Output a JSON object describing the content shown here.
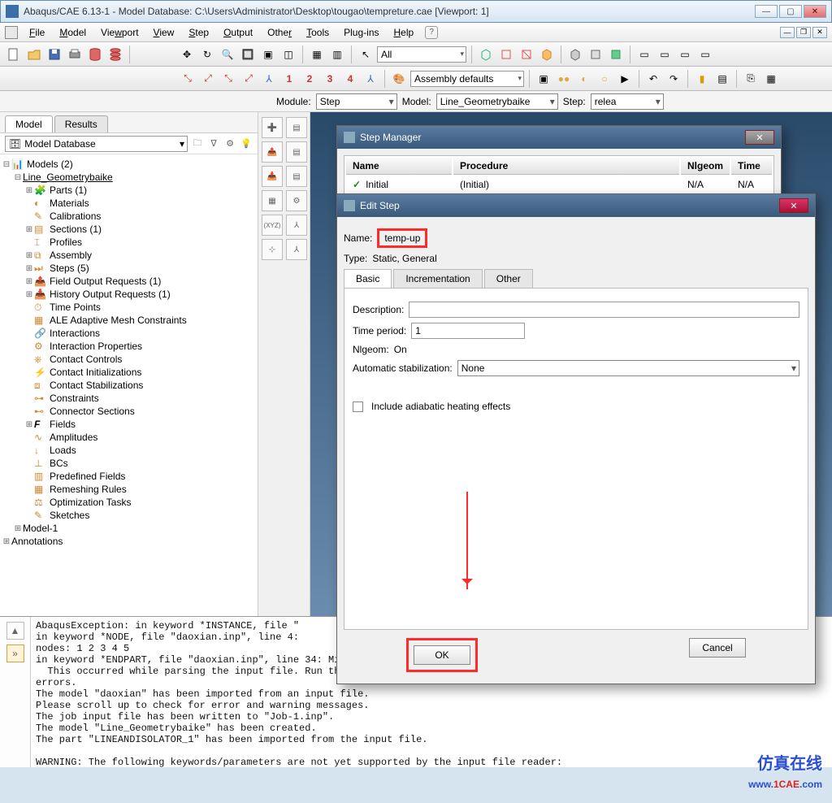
{
  "window": {
    "title": "Abaqus/CAE 6.13-1 - Model Database: C:\\Users\\Administrator\\Desktop\\tougao\\tempreture.cae [Viewport: 1]"
  },
  "menu": {
    "file": "File",
    "model": "Model",
    "viewport": "Viewport",
    "view": "View",
    "step": "Step",
    "output": "Output",
    "other": "Other",
    "tools": "Tools",
    "plugins": "Plug-ins",
    "help": "Help"
  },
  "toolbar": {
    "all": "All",
    "assembly_defaults": "Assembly defaults"
  },
  "context": {
    "module_label": "Module:",
    "module": "Step",
    "model_label": "Model:",
    "model": "Line_Geometrybaike",
    "step_label": "Step:",
    "step": "relea"
  },
  "sidebar": {
    "tabs": {
      "model": "Model",
      "results": "Results"
    },
    "model_db": "Model Database",
    "models": "Models (2)",
    "current_model": "Line_Geometrybaike",
    "items": [
      "Parts (1)",
      "Materials",
      "Calibrations",
      "Sections (1)",
      "Profiles",
      "Assembly",
      "Steps (5)",
      "Field Output Requests (1)",
      "History Output Requests (1)",
      "Time Points",
      "ALE Adaptive Mesh Constraints",
      "Interactions",
      "Interaction Properties",
      "Contact Controls",
      "Contact Initializations",
      "Contact Stabilizations",
      "Constraints",
      "Connector Sections",
      "Fields",
      "Amplitudes",
      "Loads",
      "BCs",
      "Predefined Fields",
      "Remeshing Rules",
      "Optimization Tasks",
      "Sketches"
    ],
    "model1": "Model-1",
    "annotations": "Annotations"
  },
  "step_manager": {
    "title": "Step Manager",
    "headers": {
      "name": "Name",
      "procedure": "Procedure",
      "nlgeom": "Nlgeom",
      "time": "Time"
    },
    "row": {
      "name": "Initial",
      "procedure": "(Initial)",
      "nlgeom": "N/A",
      "time": "N/A"
    }
  },
  "edit_step": {
    "title": "Edit Step",
    "name_label": "Name:",
    "name": "temp-up",
    "type_label": "Type:",
    "type": "Static, General",
    "tabs": {
      "basic": "Basic",
      "incrementation": "Incrementation",
      "other": "Other"
    },
    "description_label": "Description:",
    "description": "",
    "time_period_label": "Time period:",
    "time_period": "1",
    "nlgeom_label": "Nlgeom:",
    "nlgeom": "On",
    "auto_stab_label": "Automatic stabilization:",
    "auto_stab": "None",
    "adiabatic": "Include adiabatic heating effects",
    "ok": "OK",
    "cancel": "Cancel"
  },
  "console": {
    "text": "AbaqusException: in keyword *INSTANCE, file \"\nin keyword *NODE, file \"daoxian.inp\", line 4:\nnodes: 1 2 3 4 5\nin keyword *ENDPART, file \"daoxian.inp\", line 34: Misplaced keyword: No matching *Part keyword has been defined.\n  This occurred while parsing the input file. Run the input file through the batch pre-processor to check for syntax\nerrors.\nThe model \"daoxian\" has been imported from an input file.\nPlease scroll up to check for error and warning messages.\nThe job input file has been written to \"Job-1.inp\".\nThe model \"Line_Geometrybaike\" has been created.\nThe part \"LINEANDISOLATOR_1\" has been imported from the input file.\n\nWARNING: The following keywords/parameters are not yet supported by the input file reader:\n---------------------------------------------------------------------------------------------\n*PREPRINT"
  },
  "watermark": {
    "cn": "仿真在线",
    "url_www": "www.",
    "url_1cae": "1CAE",
    "url_com": ".com"
  }
}
